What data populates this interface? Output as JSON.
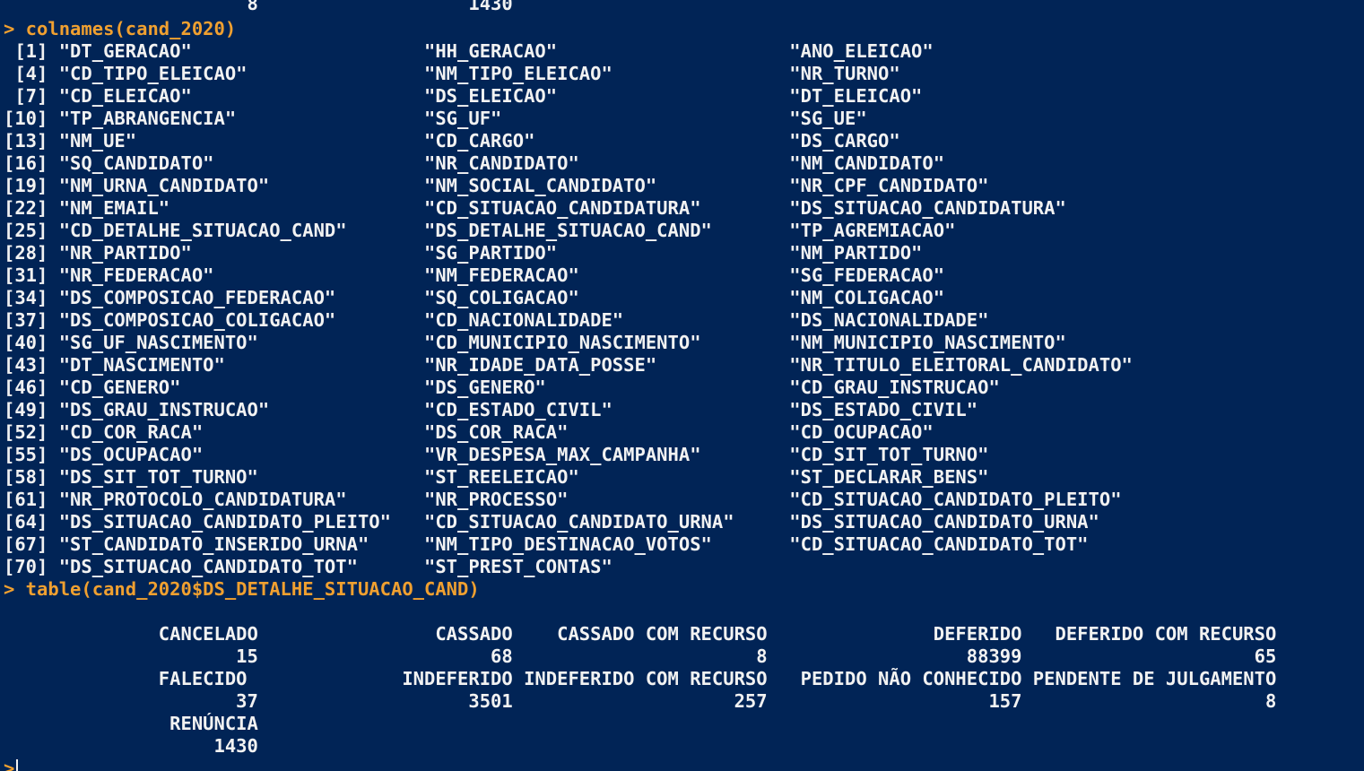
{
  "console": {
    "prompt_symbol": ">",
    "lines": [
      {
        "kind": "out",
        "text": "                      8                   1430"
      },
      {
        "kind": "cmd",
        "text": "> colnames(cand_2020)"
      },
      {
        "kind": "out",
        "text": " [1] \"DT_GERACAO\"                     \"HH_GERACAO\"                     \"ANO_ELEICAO\""
      },
      {
        "kind": "out",
        "text": " [4] \"CD_TIPO_ELEICAO\"                \"NM_TIPO_ELEICAO\"                \"NR_TURNO\""
      },
      {
        "kind": "out",
        "text": " [7] \"CD_ELEICAO\"                     \"DS_ELEICAO\"                     \"DT_ELEICAO\""
      },
      {
        "kind": "out",
        "text": "[10] \"TP_ABRANGENCIA\"                 \"SG_UF\"                          \"SG_UE\""
      },
      {
        "kind": "out",
        "text": "[13] \"NM_UE\"                          \"CD_CARGO\"                       \"DS_CARGO\""
      },
      {
        "kind": "out",
        "text": "[16] \"SQ_CANDIDATO\"                   \"NR_CANDIDATO\"                   \"NM_CANDIDATO\""
      },
      {
        "kind": "out",
        "text": "[19] \"NM_URNA_CANDIDATO\"              \"NM_SOCIAL_CANDIDATO\"            \"NR_CPF_CANDIDATO\""
      },
      {
        "kind": "out",
        "text": "[22] \"NM_EMAIL\"                       \"CD_SITUACAO_CANDIDATURA\"        \"DS_SITUACAO_CANDIDATURA\""
      },
      {
        "kind": "out",
        "text": "[25] \"CD_DETALHE_SITUACAO_CAND\"       \"DS_DETALHE_SITUACAO_CAND\"       \"TP_AGREMIACAO\""
      },
      {
        "kind": "out",
        "text": "[28] \"NR_PARTIDO\"                     \"SG_PARTIDO\"                     \"NM_PARTIDO\""
      },
      {
        "kind": "out",
        "text": "[31] \"NR_FEDERACAO\"                   \"NM_FEDERACAO\"                   \"SG_FEDERACAO\""
      },
      {
        "kind": "out",
        "text": "[34] \"DS_COMPOSICAO_FEDERACAO\"        \"SQ_COLIGACAO\"                   \"NM_COLIGACAO\""
      },
      {
        "kind": "out",
        "text": "[37] \"DS_COMPOSICAO_COLIGACAO\"        \"CD_NACIONALIDADE\"               \"DS_NACIONALIDADE\""
      },
      {
        "kind": "out",
        "text": "[40] \"SG_UF_NASCIMENTO\"               \"CD_MUNICIPIO_NASCIMENTO\"        \"NM_MUNICIPIO_NASCIMENTO\""
      },
      {
        "kind": "out",
        "text": "[43] \"DT_NASCIMENTO\"                  \"NR_IDADE_DATA_POSSE\"            \"NR_TITULO_ELEITORAL_CANDIDATO\""
      },
      {
        "kind": "out",
        "text": "[46] \"CD_GENERO\"                      \"DS_GENERO\"                      \"CD_GRAU_INSTRUCAO\""
      },
      {
        "kind": "out",
        "text": "[49] \"DS_GRAU_INSTRUCAO\"              \"CD_ESTADO_CIVIL\"                \"DS_ESTADO_CIVIL\""
      },
      {
        "kind": "out",
        "text": "[52] \"CD_COR_RACA\"                    \"DS_COR_RACA\"                    \"CD_OCUPACAO\""
      },
      {
        "kind": "out",
        "text": "[55] \"DS_OCUPACAO\"                    \"VR_DESPESA_MAX_CAMPANHA\"        \"CD_SIT_TOT_TURNO\""
      },
      {
        "kind": "out",
        "text": "[58] \"DS_SIT_TOT_TURNO\"               \"ST_REELEICAO\"                   \"ST_DECLARAR_BENS\""
      },
      {
        "kind": "out",
        "text": "[61] \"NR_PROTOCOLO_CANDIDATURA\"       \"NR_PROCESSO\"                    \"CD_SITUACAO_CANDIDATO_PLEITO\""
      },
      {
        "kind": "out",
        "text": "[64] \"DS_SITUACAO_CANDIDATO_PLEITO\"   \"CD_SITUACAO_CANDIDATO_URNA\"     \"DS_SITUACAO_CANDIDATO_URNA\""
      },
      {
        "kind": "out",
        "text": "[67] \"ST_CANDIDATO_INSERIDO_URNA\"     \"NM_TIPO_DESTINACAO_VOTOS\"       \"CD_SITUACAO_CANDIDATO_TOT\""
      },
      {
        "kind": "out",
        "text": "[70] \"DS_SITUACAO_CANDIDATO_TOT\"      \"ST_PREST_CONTAS\""
      },
      {
        "kind": "cmd",
        "text": "> table(cand_2020$DS_DETALHE_SITUACAO_CAND)"
      },
      {
        "kind": "out",
        "text": ""
      },
      {
        "kind": "out",
        "text": "              CANCELADO                CASSADO    CASSADO COM RECURSO               DEFERIDO   DEFERIDO COM RECURSO"
      },
      {
        "kind": "out",
        "text": "                     15                     68                      8                  88399                     65"
      },
      {
        "kind": "out",
        "text": "              FALECIDO              INDEFERIDO INDEFERIDO COM RECURSO   PEDIDO NÃO CONHECIDO PENDENTE DE JULGAMENTO"
      },
      {
        "kind": "out",
        "text": "                     37                   3501                    257                    157                      8"
      },
      {
        "kind": "out",
        "text": "               RENÚNCIA"
      },
      {
        "kind": "out",
        "text": "                   1430"
      }
    ]
  }
}
